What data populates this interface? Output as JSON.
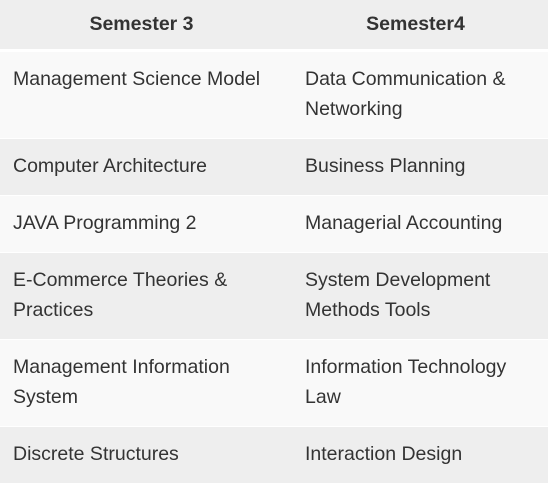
{
  "table": {
    "headers": [
      "Semester 3",
      "Semester4"
    ],
    "rows": [
      [
        "Management Science Model",
        "Data Communication & Networking"
      ],
      [
        "Computer Architecture",
        "Business Planning"
      ],
      [
        "JAVA Programming 2",
        "Managerial Accounting"
      ],
      [
        "E-Commerce Theories & Practices",
        "System Development Methods Tools"
      ],
      [
        "Management Information System",
        "Information Technology Law"
      ],
      [
        "Discrete Structures",
        "Interaction Design"
      ]
    ]
  },
  "colors": {
    "header_background": "#eeeeee",
    "row_light": "#f9f9f9",
    "row_dark": "#eeeeee",
    "text": "#333333"
  }
}
